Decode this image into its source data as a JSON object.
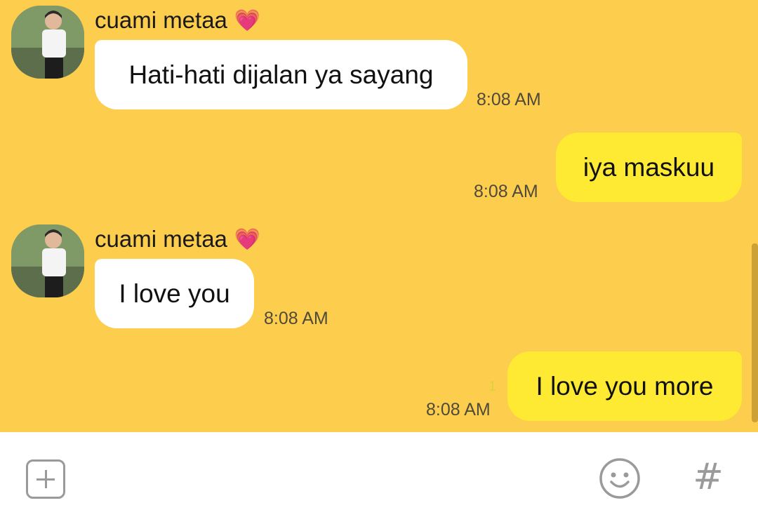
{
  "messages": [
    {
      "direction": "incoming",
      "sender": "cuami metaa",
      "sender_emoji": "💗",
      "avatar": "profile-photo",
      "text": "Hati-hati dijalan ya sayang",
      "time": "8:08 AM"
    },
    {
      "direction": "outgoing",
      "text": "iya maskuu",
      "time": "8:08 AM"
    },
    {
      "direction": "incoming",
      "sender": "cuami metaa",
      "sender_emoji": "💗",
      "avatar": "profile-photo",
      "text": "I love you",
      "time": "8:08 AM"
    },
    {
      "direction": "outgoing",
      "text": "I love you more",
      "time": "8:08 AM",
      "unread_count": "1"
    }
  ],
  "input_bar": {
    "left_icon": "plus-box-icon",
    "right_icons": [
      "smiley-icon",
      "hash-icon"
    ],
    "hash_glyph": "#"
  },
  "colors": {
    "chat_background": "#FDCD4E",
    "incoming_bubble": "#FFFFFF",
    "outgoing_bubble": "#FEE933",
    "unread_counter": "#DCD23A",
    "icon_gray": "#9A9A9A"
  }
}
